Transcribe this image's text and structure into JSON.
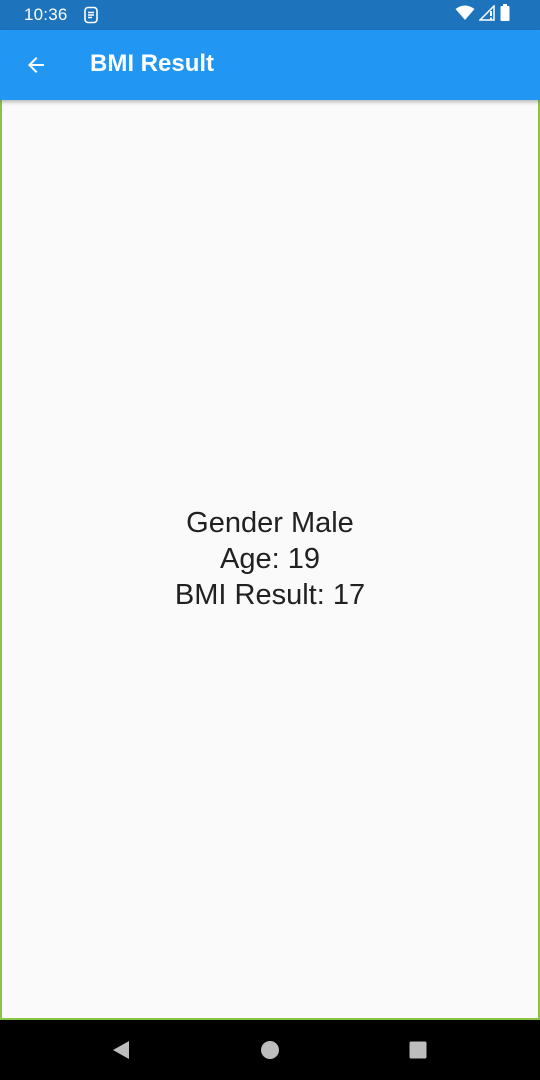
{
  "status_bar": {
    "time": "10:36",
    "icons": [
      "app-notification-icon",
      "wifi-icon",
      "cell-signal-icon",
      "battery-icon"
    ]
  },
  "app_bar": {
    "title": "BMI Result",
    "back_icon": "arrow-back-icon",
    "color": "#2196f3"
  },
  "result": {
    "gender_line": "Gender Male",
    "age_line": "Age: 19",
    "bmi_line": "BMI Result: 17"
  },
  "nav_bar": {
    "icons": [
      "nav-back-icon",
      "nav-home-icon",
      "nav-recents-icon"
    ]
  },
  "colors": {
    "status_bar": "#1e73bd",
    "app_bar": "#2196f3",
    "content_bg": "#fafafa",
    "frame_border": "#8bc34a",
    "text": "#212121"
  }
}
